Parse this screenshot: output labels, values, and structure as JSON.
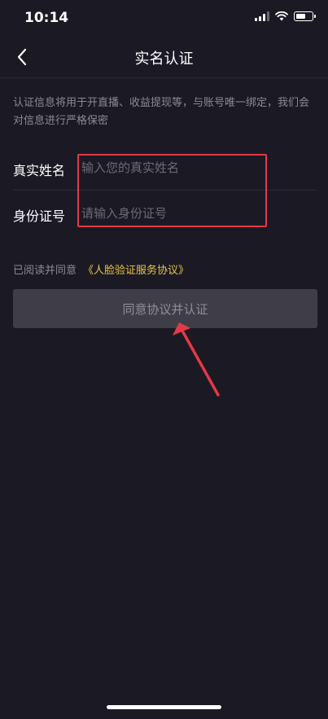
{
  "status_bar": {
    "time": "10:14",
    "signal_icon": "cellular-signal-icon",
    "wifi_icon": "wifi-icon",
    "battery_icon": "battery-icon",
    "battery_level": 0.6
  },
  "nav": {
    "back_icon": "chevron-left-icon",
    "title": "实名认证"
  },
  "notice": "认证信息将用于开直播、收益提现等，与账号唯一绑定，我们会对信息进行严格保密",
  "form": {
    "name": {
      "label": "真实姓名",
      "placeholder": "输入您的真实姓名",
      "value": ""
    },
    "id_number": {
      "label": "身份证号",
      "placeholder": "请输入身份证号",
      "value": ""
    }
  },
  "agreement": {
    "prefix": "已阅读并同意",
    "link": "《人脸验证服务协议》"
  },
  "submit": {
    "label": "同意协议并认证"
  },
  "colors": {
    "background": "#1b1a24",
    "link": "#e8c44a",
    "annotation": "#e23a46",
    "button_bg": "#3f3e48"
  }
}
